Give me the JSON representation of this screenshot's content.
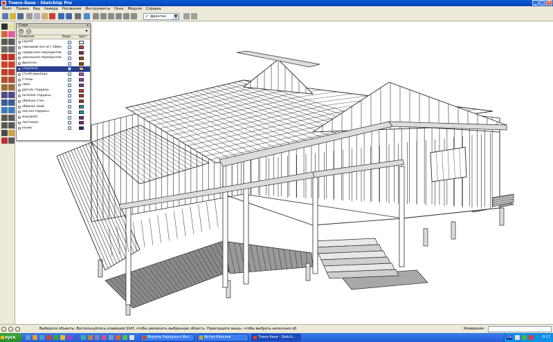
{
  "window": {
    "title": "Томск-баня - SketchUp Pro"
  },
  "menu": [
    "Файл",
    "Правка",
    "Вид",
    "Камера",
    "Рисование",
    "Инструменты",
    "Окно",
    "Модули",
    "Справка"
  ],
  "toolbar": {
    "scene": "фронтон"
  },
  "layers_panel": {
    "title": "Слои",
    "headers": {
      "name": "Название",
      "visible": "Види...",
      "color": "Цвет"
    },
    "rows": [
      {
        "name": "Layer0",
        "visible": false,
        "color": "#ffffff",
        "selected": false
      },
      {
        "name": "черновой пол ост 18мм",
        "visible": false,
        "color": "#c0392b",
        "selected": false
      },
      {
        "name": "чердачное перекрытие",
        "visible": true,
        "color": "#8e2a2a",
        "selected": false
      },
      {
        "name": "цокольное перекрытие",
        "visible": false,
        "color": "#8a5a00",
        "selected": false
      },
      {
        "name": "фронтон",
        "visible": true,
        "color": "#a04000",
        "selected": false
      },
      {
        "name": "стропила",
        "visible": false,
        "color": "#e0c0a0",
        "selected": true
      },
      {
        "name": "столб крыльца",
        "visible": true,
        "color": "#9b59b6",
        "selected": false
      },
      {
        "name": "Стены",
        "visible": true,
        "color": "#8e44ad",
        "selected": false
      },
      {
        "name": "сваи",
        "visible": true,
        "color": "#7d3c98",
        "selected": false
      },
      {
        "name": "ригель террасы",
        "visible": true,
        "color": "#c0392b",
        "selected": false
      },
      {
        "name": "потолок террасы",
        "visible": true,
        "color": "#b03a2e",
        "selected": false
      },
      {
        "name": "обвязка стен",
        "visible": true,
        "color": "#a93226",
        "selected": false
      },
      {
        "name": "обвязка свай",
        "visible": true,
        "color": "#1a9a8a",
        "selected": false
      },
      {
        "name": "настил террасы",
        "visible": true,
        "color": "#16a085",
        "selected": false
      },
      {
        "name": "мауэрлат",
        "visible": true,
        "color": "#6c2a8a",
        "selected": false
      },
      {
        "name": "лестница",
        "visible": true,
        "color": "#8e1a8a",
        "selected": false
      },
      {
        "name": "конек",
        "visible": true,
        "color": "#1a2a8a",
        "selected": false
      }
    ]
  },
  "status": {
    "message": "Выберите объекты. Воспользуйтесь клавишей Shift, чтобы увеличить выбранную область. Перетащите мышь, чтобы выбрать несколько об",
    "measure_label": "Измерения",
    "measure_value": ""
  },
  "taskbar": {
    "start": "пуск",
    "tasks": [
      {
        "label": "Форумы Народного Инт...",
        "active": false,
        "icon_color": "#d04020"
      },
      {
        "label": "Артем Киселев",
        "active": false,
        "icon_color": "#e0a020"
      },
      {
        "label": "Томск-баня - Sketch...",
        "active": true,
        "icon_color": "#e04020"
      }
    ],
    "lang": "EN",
    "clock": "0:17"
  }
}
